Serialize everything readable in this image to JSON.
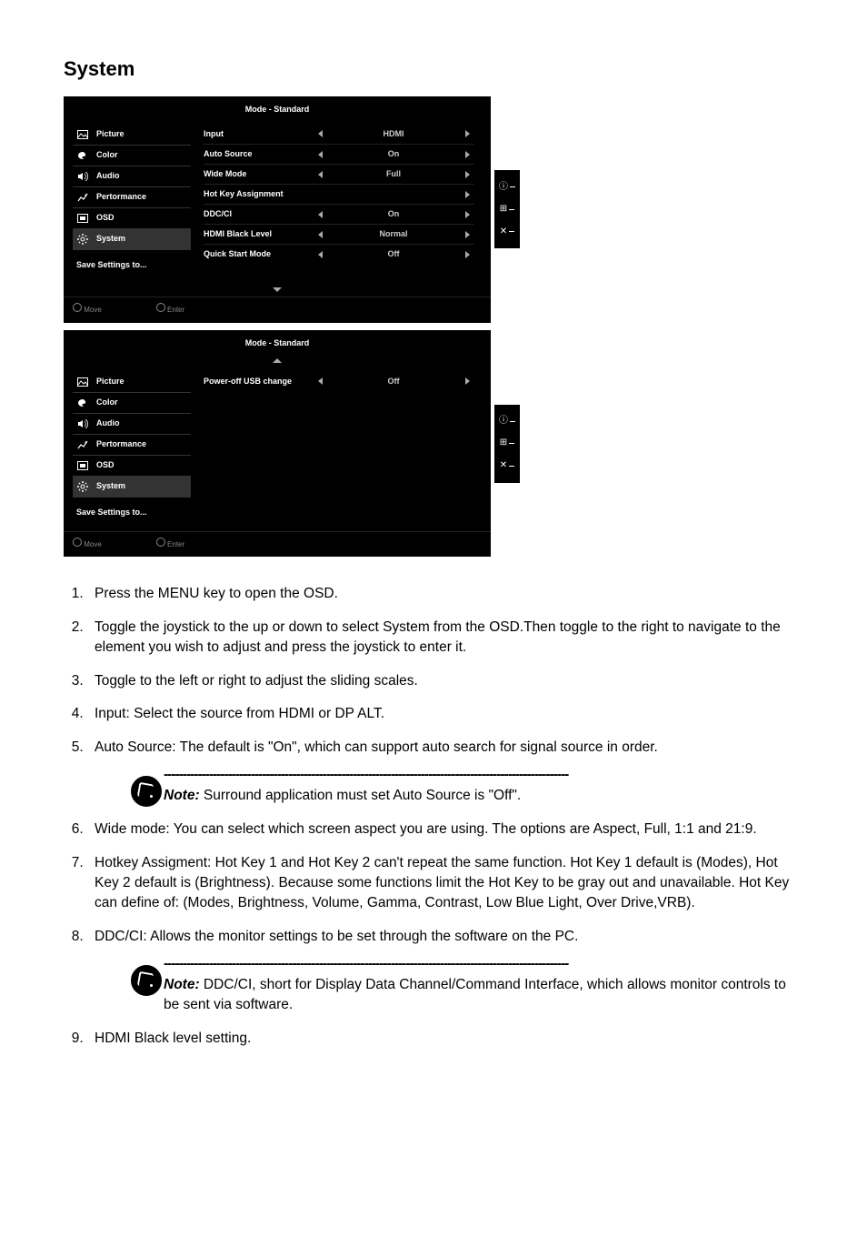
{
  "title": "System",
  "osd_mode": "Mode - Standard",
  "menu": {
    "picture": "Picture",
    "color": "Color",
    "audio": "Audio",
    "performance": "Pertormance",
    "osd": "OSD",
    "system": "System",
    "save": "Save Settings to..."
  },
  "settings1": [
    {
      "label": "Input",
      "value": "HDMI",
      "left": true,
      "right": true
    },
    {
      "label": "Auto Source",
      "value": "On",
      "left": true,
      "right": true
    },
    {
      "label": "Wide Mode",
      "value": "Full",
      "left": true,
      "right": true
    },
    {
      "label": "Hot Key Assignment",
      "value": "",
      "left": false,
      "right": true
    },
    {
      "label": "DDC/CI",
      "value": "On",
      "left": true,
      "right": true
    },
    {
      "label": "HDMI Black Level",
      "value": "Normal",
      "left": true,
      "right": true
    },
    {
      "label": "Quick Start Mode",
      "value": "Off",
      "left": true,
      "right": true
    }
  ],
  "settings2": [
    {
      "label": "Power-off USB change",
      "value": "Off",
      "left": true,
      "right": true
    }
  ],
  "footer": {
    "move": "Move",
    "enter": "Enter"
  },
  "side_icons": {
    "info": "ⓘ",
    "grid": "⊞",
    "close": "✕"
  },
  "steps": {
    "1": "Press the MENU key to open the OSD.",
    "2": "Toggle the joystick to the up or down to select System from the OSD.Then toggle to the right to navigate to the element you wish to adjust and press the joystick to enter it.",
    "3": "Toggle to the left or right to adjust the sliding scales.",
    "4_a": "Input: Select the source fro",
    "4_b": "m HDMI or DP ALT.",
    "5": "Auto Source: The default is \"On\", which can support auto search for signal source in order.",
    "6": "Wide mode: You can select which screen aspect you are using. The options are Aspect, Full, 1:1 and 21:9.",
    "7": "Hotkey Assigment: Hot Key 1 and Hot Key 2 can't repeat the same function. Hot Key 1 default is (Modes), Hot Key 2 default is (Brightness). Because some functions limit the Hot Key to be gray out and unavailable. Hot Key can define of: (Modes, Brightness, Volume, Gamma, Contrast, Low Blue Light, Over Drive,VRB).",
    "8": "DDC/CI: Allows the monitor settings to be set through the software on the PC.",
    "9": "HDMI Black level setting."
  },
  "notes": {
    "label": "Note:",
    "dash": "-----------------------------------------------------------------------------------------------------------",
    "n1": " Surround application must set Auto Source is \"Off\".",
    "n2": " DDC/CI, short for Display Data Channel/Command Interface, which allows monitor controls to be sent via software."
  }
}
